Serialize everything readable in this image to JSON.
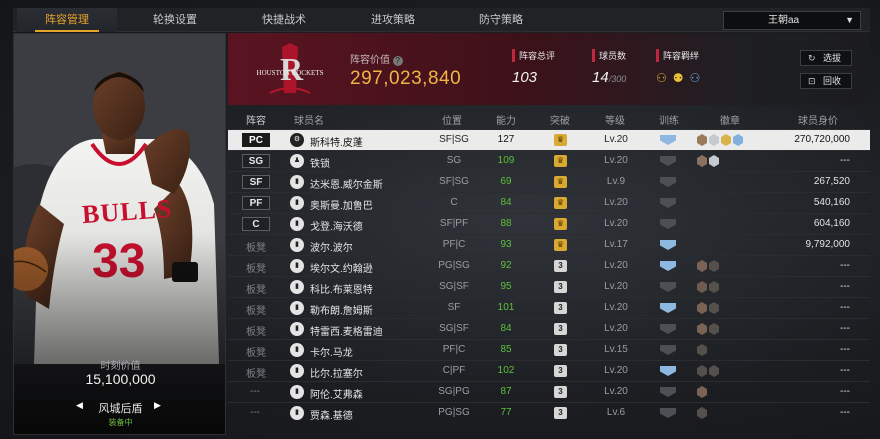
{
  "tabs": [
    {
      "label": "阵容管理",
      "active": true
    },
    {
      "label": "轮换设置",
      "active": false
    },
    {
      "label": "快捷战术",
      "active": false
    },
    {
      "label": "进攻策略",
      "active": false
    },
    {
      "label": "防守策略",
      "active": false
    }
  ],
  "account": {
    "name": "王朝aa"
  },
  "player_card": {
    "jersey_text": "BULLS",
    "jersey_number": "33",
    "value_label": "时刻价值",
    "value": "15,100,000",
    "name": "风城后盾",
    "status": "装备中"
  },
  "team": {
    "logo_text": "HOUSTON ROCKETS",
    "logo_letter": "R",
    "value_label": "阵容价值",
    "value": "297,023,840",
    "rating_label": "阵容总评",
    "rating": "103",
    "count_label": "球员数",
    "count": "14",
    "count_max": "/300",
    "bond_label": "阵容羁绊"
  },
  "buttons": {
    "select": "选拔",
    "recycle": "回收"
  },
  "headers": [
    "阵容",
    "球员名",
    "位置",
    "能力",
    "突破",
    "等级",
    "训练",
    "徽章",
    "球员身价"
  ],
  "rows": [
    {
      "slot": "PC",
      "slot_type": "pos",
      "name": "斯科特.皮蓬",
      "pos": "SF|SG",
      "rating": "127",
      "brk": "♛",
      "brk_type": "gold",
      "level": "Lv.20",
      "train": "blue",
      "badges": [
        "#9a7a5a",
        "#c7c9d0",
        "#d8b34a",
        "#7fb0de"
      ],
      "value": "270,720,000",
      "selected": true
    },
    {
      "slot": "SG",
      "slot_type": "pos",
      "name": "铁锁",
      "pos": "SG",
      "rating": "109",
      "brk": "♛",
      "brk_type": "gold",
      "level": "Lv.20",
      "train": "grey",
      "badges": [
        "#8a7160",
        "#c7c9d0"
      ],
      "value": "---"
    },
    {
      "slot": "SF",
      "slot_type": "pos",
      "name": "达米恩.威尔金斯",
      "pos": "SF|SG",
      "rating": "69",
      "brk": "♛",
      "brk_type": "gold",
      "level": "Lv.9",
      "train": "grey",
      "badges": [],
      "value": "267,520"
    },
    {
      "slot": "PF",
      "slot_type": "pos",
      "name": "奥斯曼.加鲁巴",
      "pos": "C",
      "rating": "84",
      "brk": "♛",
      "brk_type": "gold",
      "level": "Lv.20",
      "train": "grey",
      "badges": [],
      "value": "540,160"
    },
    {
      "slot": "C",
      "slot_type": "pos",
      "name": "戈登.海沃德",
      "pos": "SF|PF",
      "rating": "88",
      "brk": "♛",
      "brk_type": "gold",
      "level": "Lv.20",
      "train": "grey",
      "badges": [],
      "value": "604,160"
    },
    {
      "slot": "板凳",
      "slot_type": "bench",
      "name": "波尔.波尔",
      "pos": "PF|C",
      "rating": "93",
      "brk": "♛",
      "brk_type": "gold",
      "level": "Lv.17",
      "train": "blue",
      "badges": [],
      "value": "9,792,000"
    },
    {
      "slot": "板凳",
      "slot_type": "bench",
      "name": "埃尔文.约翰逊",
      "pos": "PG|SG",
      "rating": "92",
      "brk": "3",
      "brk_type": "grey",
      "level": "Lv.20",
      "train": "blue",
      "badges": [
        "#7a6254",
        "#55504c"
      ],
      "value": "---"
    },
    {
      "slot": "板凳",
      "slot_type": "bench",
      "name": "科比.布莱恩特",
      "pos": "SG|SF",
      "rating": "95",
      "brk": "3",
      "brk_type": "grey",
      "level": "Lv.20",
      "train": "grey",
      "badges": [
        "#6e5a4e",
        "#55504c"
      ],
      "value": "---"
    },
    {
      "slot": "板凳",
      "slot_type": "bench",
      "name": "勒布朗.詹姆斯",
      "pos": "SF",
      "rating": "101",
      "brk": "3",
      "brk_type": "grey",
      "level": "Lv.20",
      "train": "blue",
      "badges": [
        "#7a6254",
        "#55504c"
      ],
      "value": "---"
    },
    {
      "slot": "板凳",
      "slot_type": "bench",
      "name": "特雷西.麦格雷迪",
      "pos": "SG|SF",
      "rating": "84",
      "brk": "3",
      "brk_type": "grey",
      "level": "Lv.20",
      "train": "grey",
      "badges": [
        "#7a6254",
        "#55504c"
      ],
      "value": "---"
    },
    {
      "slot": "板凳",
      "slot_type": "bench",
      "name": "卡尔.马龙",
      "pos": "PF|C",
      "rating": "85",
      "brk": "3",
      "brk_type": "grey",
      "level": "Lv.15",
      "train": "grey",
      "badges": [
        "#55504c"
      ],
      "value": "---"
    },
    {
      "slot": "板凳",
      "slot_type": "bench",
      "name": "比尔.拉塞尔",
      "pos": "C|PF",
      "rating": "102",
      "brk": "3",
      "brk_type": "grey",
      "level": "Lv.20",
      "train": "blue",
      "badges": [
        "#55504c",
        "#55504c"
      ],
      "value": "---"
    },
    {
      "slot": "---",
      "slot_type": "dash",
      "name": "阿伦.艾弗森",
      "pos": "SG|PG",
      "rating": "87",
      "brk": "3",
      "brk_type": "grey",
      "level": "Lv.20",
      "train": "grey",
      "badges": [
        "#7a6254"
      ],
      "value": "---"
    },
    {
      "slot": "---",
      "slot_type": "dash",
      "name": "贾森.基德",
      "pos": "PG|SG",
      "rating": "77",
      "brk": "3",
      "brk_type": "grey",
      "level": "Lv.6",
      "train": "grey",
      "badges": [
        "#55504c"
      ],
      "value": "---"
    }
  ],
  "colors": {
    "accent": "#e8a52e",
    "rating_green": "#5fbf3b",
    "team_red": "#5a1421",
    "gold": "#d9a932"
  }
}
